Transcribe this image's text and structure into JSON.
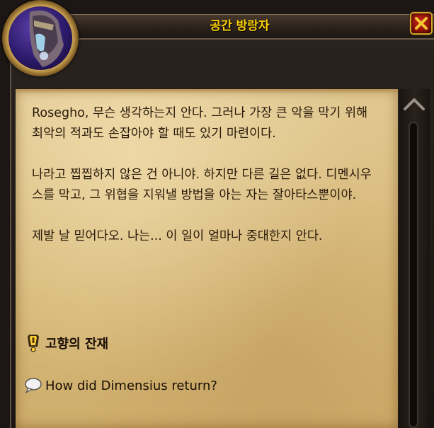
{
  "window": {
    "title": "공간 방랑자"
  },
  "dialog": {
    "paragraphs": [
      "Rosegho, 무슨 생각하는지 안다. 그러나 가장 큰 악을 막기 위해 최악의 적과도 손잡아야 할 때도 있기 마련이다.",
      "나라고 찝찝하지 않은 건 아니야. 하지만 다른 길은 없다. 디멘시우스를 막고, 그 위협을 지워낼 방법을 아는 자는 잘아타스뿐이야.",
      "제발 날 믿어다오. 나는... 이 일이 얼마나 중대한지 안다."
    ]
  },
  "options": [
    {
      "label": "고향의 잔재",
      "icon": "quest-exclamation-icon"
    },
    {
      "label": "How did Dimensius return?",
      "icon": "chat-bubble-icon"
    }
  ],
  "colors": {
    "title": "#ffd100",
    "parchment": "#d6b878",
    "text": "#2a1a0a",
    "close_button": "#b0180e"
  }
}
